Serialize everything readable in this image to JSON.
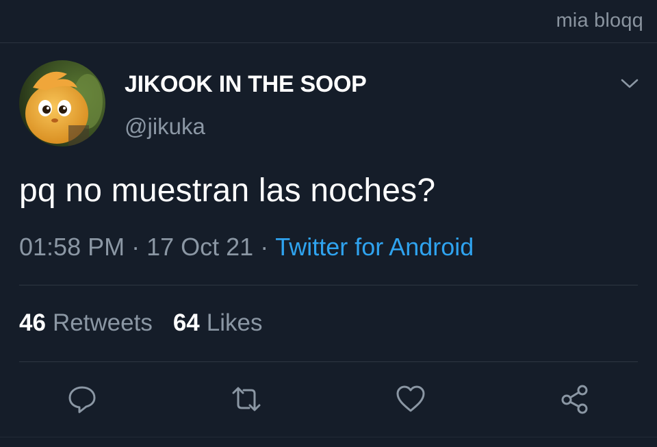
{
  "header": {
    "title": "mia bloqq"
  },
  "tweet": {
    "display_name": "JIKOOK IN THE SOOP",
    "handle": "@jikuka",
    "text": "pq no muestran las noches?",
    "time": "01:58 PM",
    "separator": "·",
    "date": "17 Oct 21",
    "source": "Twitter for Android"
  },
  "stats": {
    "retweets_count": "46",
    "retweets_label": "Retweets",
    "likes_count": "64",
    "likes_label": "Likes"
  },
  "actions": {
    "reply_icon": "reply-icon",
    "retweet_icon": "retweet-icon",
    "like_icon": "heart-icon",
    "share_icon": "share-icon"
  },
  "colors": {
    "background": "#151d29",
    "link": "#2fa3ef",
    "secondary_text": "#8b97a4"
  }
}
